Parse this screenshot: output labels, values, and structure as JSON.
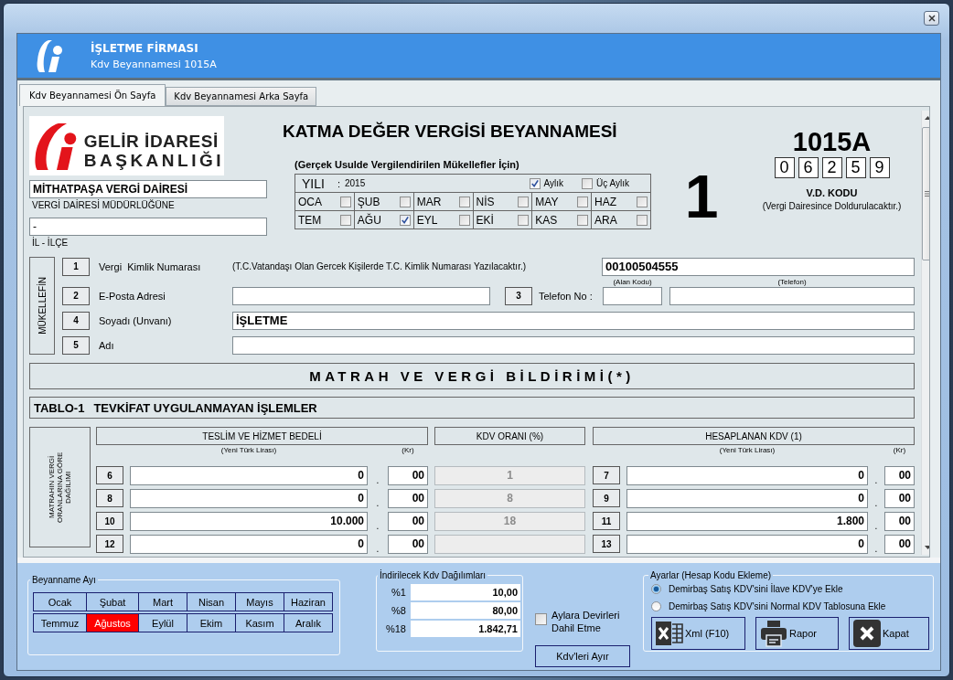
{
  "header": {
    "title": "İŞLETME FİRMASI",
    "subtitle": "Kdv Beyannamesi 1015A"
  },
  "tabs": [
    {
      "label": "Kdv Beyannamesi Ön Sayfa",
      "selected": true
    },
    {
      "label": "Kdv Beyannamesi Arka Sayfa",
      "selected": false
    }
  ],
  "form": {
    "logo_lines": [
      "GELİR İDARESİ",
      "BAŞKANLIĞI"
    ],
    "title": "KATMA DEĞER VERGİSİ BEYANNAMESİ",
    "subtitle": "(Gerçek Usulde Vergilendirilen Mükellefler İçin)",
    "tax_office": {
      "value": "MİTHATPAŞA VERGİ DAİRESİ",
      "label": "VERGİ DAİRESİ MÜDÜRLÜĞÜNE"
    },
    "district": {
      "value": "-",
      "label": "İL - İLÇE"
    },
    "year": {
      "label": "YILI",
      "separator": ":",
      "value": "2015"
    },
    "periods": [
      {
        "label": "Aylık",
        "checked": true
      },
      {
        "label": "Üç Aylık",
        "checked": false
      }
    ],
    "months": [
      {
        "label": "OCA",
        "checked": false
      },
      {
        "label": "ŞUB",
        "checked": false
      },
      {
        "label": "MAR",
        "checked": false
      },
      {
        "label": "NİS",
        "checked": false
      },
      {
        "label": "MAY",
        "checked": false
      },
      {
        "label": "HAZ",
        "checked": false
      },
      {
        "label": "TEM",
        "checked": false
      },
      {
        "label": "AĞU",
        "checked": true
      },
      {
        "label": "EYL",
        "checked": false
      },
      {
        "label": "EKİ",
        "checked": false
      },
      {
        "label": "KAS",
        "checked": false
      },
      {
        "label": "ARA",
        "checked": false
      }
    ],
    "page_number": "1",
    "form_code": "1015A",
    "office_code": {
      "digits": [
        "0",
        "6",
        "2",
        "5",
        "9"
      ],
      "label": "V.D. KODU",
      "note": "(Vergi Dairesince Doldurulacaktır.)"
    }
  },
  "taxpayer": {
    "section_label": "MÜKELLEFİN",
    "tax_id": {
      "number": "1",
      "label": "Vergi  Kimlik Numarası",
      "note": "(T.C.Vatandaşı Olan Gercek Kişilerde T.C. Kimlik Numarası Yazılacaktır.)",
      "value": "00100504555"
    },
    "email": {
      "number": "2",
      "label": "E-Posta Adresi"
    },
    "phone": {
      "number": "3",
      "label": "Telefon No :",
      "area_caption": "(Alan Kodu)",
      "phone_caption": "(Telefon)"
    },
    "surname": {
      "number": "4",
      "label": "Soyadı (Unvanı)",
      "value": "İŞLETME"
    },
    "name": {
      "number": "5",
      "label": "Adı"
    }
  },
  "declaration": {
    "title": "MATRAH VE VERGİ BİLDİRİMİ(*)",
    "table_code": "TABLO-1",
    "table_title": "TEVKİFAT UYGULANMAYAN İŞLEMLER",
    "side_label": "MATRAHIN VERGİ ORANLARINA GÖRE DAĞILIMI",
    "columns": [
      "TESLİM VE HİZMET BEDELİ",
      "KDV ORANI (%)",
      "HESAPLANAN KDV (1)"
    ],
    "captions": [
      "(Yeni Türk Lirası)",
      "(Kr)",
      "(Yeni Türk Lirası)",
      "(Kr)"
    ],
    "rows": [
      {
        "base_no": "6",
        "base": "0",
        "base_sep": ".",
        "base_kr": "00",
        "rate": "1",
        "tax_no": "7",
        "tax": "0",
        "tax_sep": ".",
        "tax_kr": "00"
      },
      {
        "base_no": "8",
        "base": "0",
        "base_sep": ".",
        "base_kr": "00",
        "rate": "8",
        "tax_no": "9",
        "tax": "0",
        "tax_sep": ".",
        "tax_kr": "00"
      },
      {
        "base_no": "10",
        "base": "10.000",
        "base_sep": ".",
        "base_kr": "00",
        "rate": "18",
        "tax_no": "11",
        "tax": "1.800",
        "tax_sep": ".",
        "tax_kr": "00"
      },
      {
        "base_no": "12",
        "base": "0",
        "base_sep": ".",
        "base_kr": "00",
        "tax_no": "13",
        "tax": "0",
        "tax_sep": ".",
        "tax_kr": "00"
      }
    ]
  },
  "months_panel": {
    "title": "Beyanname Ayı",
    "months": [
      {
        "label": "Ocak",
        "selected": false
      },
      {
        "label": "Şubat",
        "selected": false
      },
      {
        "label": "Mart",
        "selected": false
      },
      {
        "label": "Nisan",
        "selected": false
      },
      {
        "label": "Mayıs",
        "selected": false
      },
      {
        "label": "Haziran",
        "selected": false
      },
      {
        "label": "Temmuz",
        "selected": false
      },
      {
        "label": "Ağustos",
        "selected": true
      },
      {
        "label": "Eylül",
        "selected": false
      },
      {
        "label": "Ekim",
        "selected": false
      },
      {
        "label": "Kasım",
        "selected": false
      },
      {
        "label": "Aralık",
        "selected": false
      }
    ]
  },
  "deductions": {
    "title": "İndirilecek Kdv Dağılımları",
    "rows": [
      {
        "label": "%1",
        "value": "10,00"
      },
      {
        "label": "%8",
        "value": "80,00"
      },
      {
        "label": "%18",
        "value": "1.842,71"
      }
    ]
  },
  "carry_over": {
    "label": "Aylara Devirleri Dahil Etme",
    "checked": false
  },
  "split_button": "Kdv'leri Ayır",
  "settings": {
    "title": "Ayarlar (Hesap Kodu Ekleme)",
    "options": [
      {
        "label": "Demirbaş Satış KDV'sini İlave KDV'ye Ekle",
        "selected": true
      },
      {
        "label": "Demirbaş Satış KDV'sini Normal KDV Tablosuna Ekle",
        "selected": false
      }
    ]
  },
  "actions": [
    {
      "kind": "xml",
      "label": "Xml (F10)"
    },
    {
      "kind": "print",
      "label": "Rapor"
    },
    {
      "kind": "close",
      "label": "Kapat"
    }
  ]
}
